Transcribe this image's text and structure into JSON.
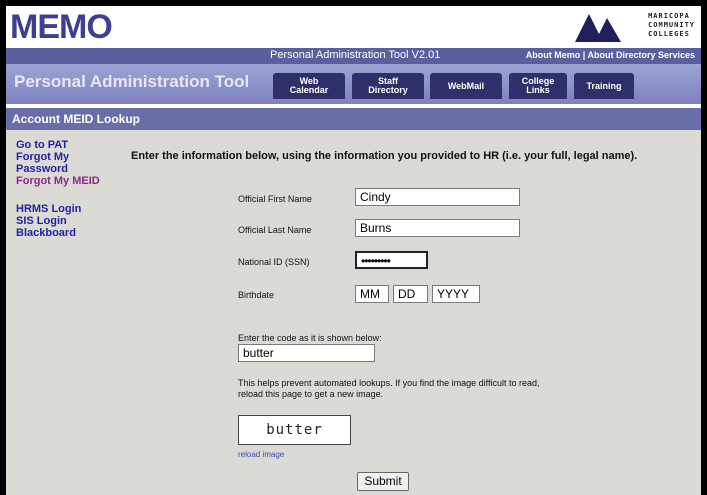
{
  "header": {
    "logo": "MEMO",
    "college_logo_lines": [
      "MARICOPA",
      "COMMUNITY",
      "COLLEGES"
    ],
    "version": "Personal Administration Tool V2.01",
    "link_about_memo": "About Memo",
    "link_separator": "|",
    "link_about_directory": "About Directory Services",
    "app_title": "Personal Administration Tool"
  },
  "tabs": [
    {
      "label": "Web\nCalendar"
    },
    {
      "label": "Staff\nDirectory"
    },
    {
      "label": "WebMail"
    },
    {
      "label": "College\nLinks"
    },
    {
      "label": "Training"
    }
  ],
  "section_title": "Account MEID Lookup",
  "sidebar": {
    "items": [
      {
        "label": "Go to PAT"
      },
      {
        "label": "Forgot My Password"
      },
      {
        "label": "Forgot My MEID"
      },
      {
        "label": "HRMS Login"
      },
      {
        "label": "SIS Login"
      },
      {
        "label": "Blackboard"
      }
    ]
  },
  "form": {
    "intro": "Enter the information below, using the information you provided to HR (i.e. your full, legal name).",
    "first_name_label": "Official First Name",
    "first_name_value": "Cindy",
    "last_name_label": "Official Last Name",
    "last_name_value": "Burns",
    "ssn_label": "National ID (SSN)",
    "ssn_value": "•••••••••",
    "birthdate_label": "Birthdate",
    "birth_mm": "MM",
    "birth_dd": "DD",
    "birth_yyyy": "YYYY",
    "code_prompt": "Enter the code as it is shown below:",
    "code_value": "butter",
    "help_text_1": "This helps prevent automated lookups. If you find the image difficult to read,",
    "help_text_2": "reload this page to get a new image.",
    "captcha_text": "butter",
    "reload_link": "reload image",
    "submit_label": "Submit"
  },
  "colors": {
    "brand": "#3e3f90",
    "nav_bar": "#5b5f9e",
    "title_bar": "#6a6ea8",
    "tab": "#2f2f6c",
    "link": "#2323a0",
    "active_link": "#8a2a8a"
  }
}
